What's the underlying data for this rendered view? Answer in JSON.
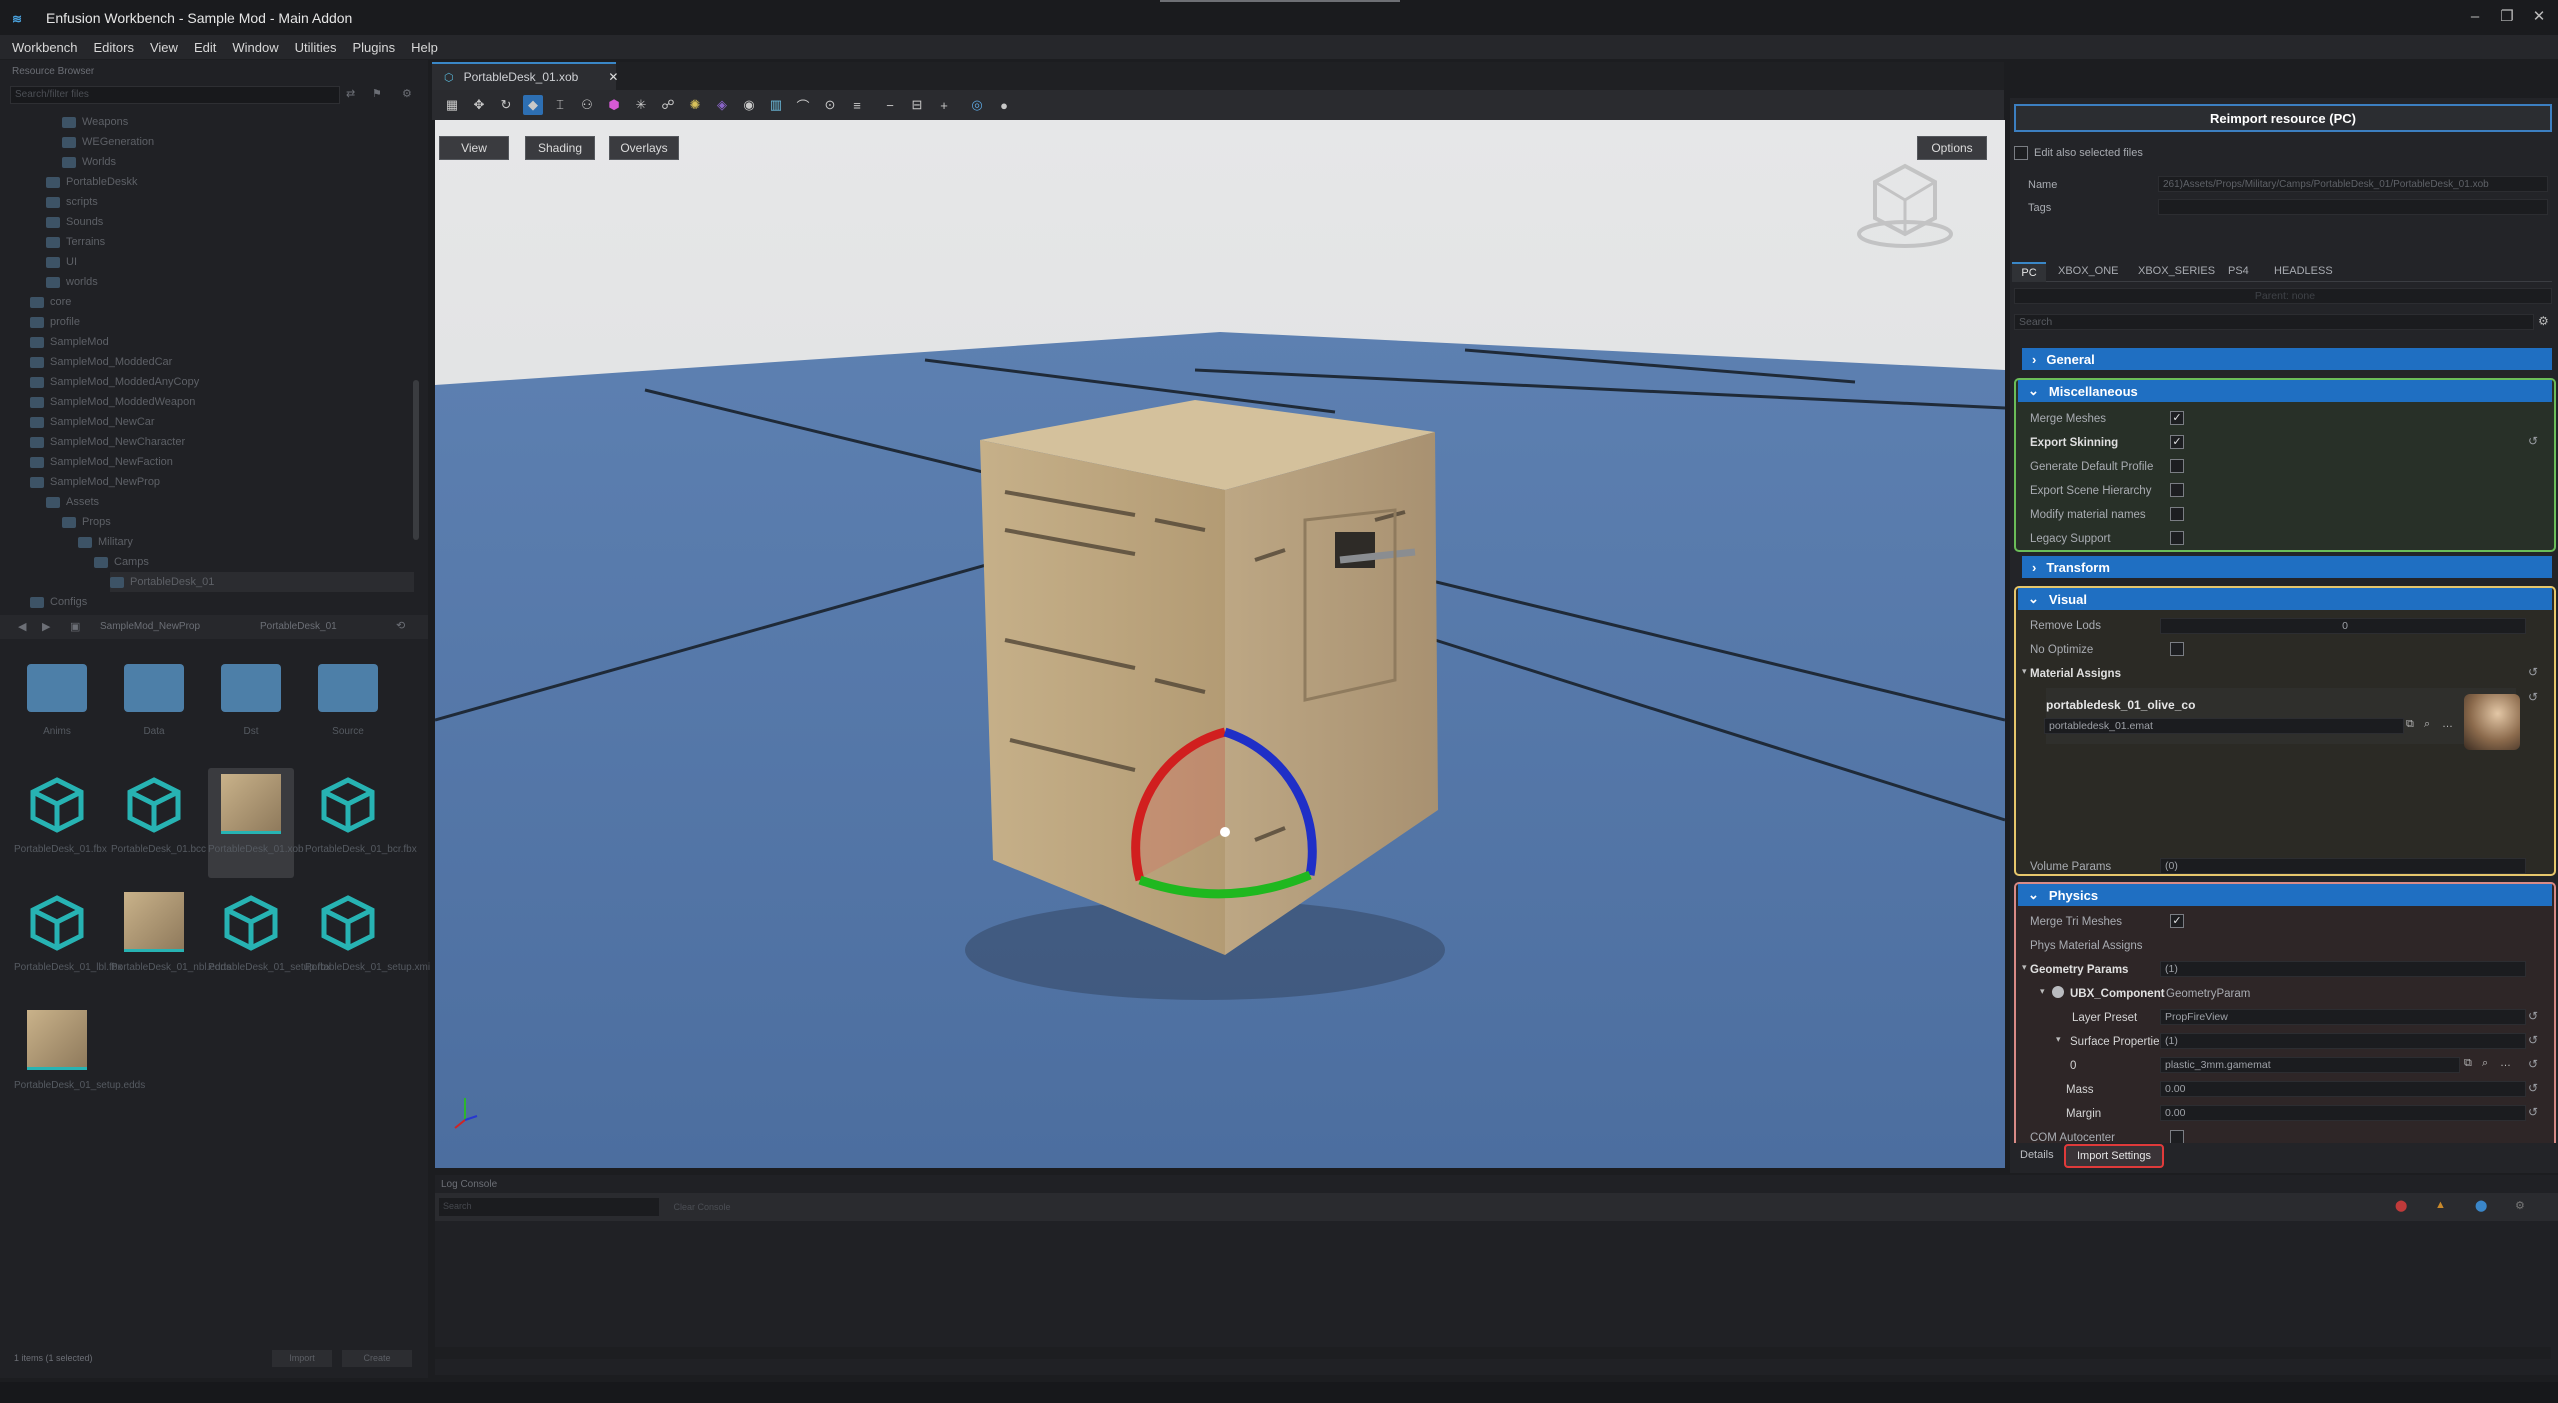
{
  "window": {
    "title": "Enfusion Workbench - Sample Mod - Main Addon",
    "minimize": "–",
    "maximize": "❐",
    "close": "✕"
  },
  "menu": [
    "Workbench",
    "Editors",
    "View",
    "Edit",
    "Window",
    "Utilities",
    "Plugins",
    "Help"
  ],
  "resource_browser": {
    "title": "Resource Browser",
    "search_placeholder": "Search/filter files",
    "tree": [
      "Weapons",
      "WEGeneration",
      "Worlds",
      "PortableDeskk",
      "scripts",
      "Sounds",
      "Terrains",
      "UI",
      "worlds",
      "core",
      "profile",
      "SampleMod",
      "SampleMod_ModdedCar",
      "SampleMod_ModdedAnyCopy",
      "SampleMod_ModdedWeapon",
      "SampleMod_NewCar",
      "SampleMod_NewCharacter",
      "SampleMod_NewFaction",
      "SampleMod_NewProp",
      "Assets",
      "Props",
      "Military",
      "Camps",
      "PortableDesk_01",
      "Configs"
    ],
    "path": [
      "SampleMod_NewProp",
      "PortableDesk_01"
    ],
    "assets": [
      {
        "label": "Anims",
        "kind": "folder"
      },
      {
        "label": "Data",
        "kind": "folder"
      },
      {
        "label": "Dst",
        "kind": "folder"
      },
      {
        "label": "Source",
        "kind": "folder"
      },
      {
        "label": "PortableDesk_01.fbx",
        "kind": "model"
      },
      {
        "label": "PortableDesk_01.bcc",
        "kind": "model"
      },
      {
        "label": "PortableDesk_01.xob",
        "kind": "image"
      },
      {
        "label": "PortableDesk_01_bcr.fbx",
        "kind": "model"
      },
      {
        "label": "PortableDesk_01_lbl.fbx",
        "kind": "model"
      },
      {
        "label": "PortableDesk_01_nbl.edds",
        "kind": "image"
      },
      {
        "label": "PortableDesk_01_setup.fbx",
        "kind": "model"
      },
      {
        "label": "PortableDesk_01_setup.xmi",
        "kind": "model"
      },
      {
        "label": "PortableDesk_01_setup.edds",
        "kind": "image"
      }
    ],
    "selection": "1 items (1 selected)",
    "import_button": "Import",
    "create_button": "Create"
  },
  "editor": {
    "tab_label": "PortableDesk_01.xob",
    "tab_close": "✕",
    "viewport_buttons": {
      "view": "View",
      "shading": "Shading",
      "overlays": "Overlays",
      "options": "Options"
    }
  },
  "details": {
    "reimport_button": "Reimport resource (PC)",
    "edit_selected": "Edit also selected files",
    "name_label": "Name",
    "name_value": "261)Assets/Props/Military/Camps/PortableDesk_01/PortableDesk_01.xob",
    "tags_label": "Tags",
    "platform_tabs": [
      "PC",
      "XBOX_ONE",
      "XBOX_SERIES",
      "PS4",
      "HEADLESS"
    ],
    "parent_label": "Parent: none",
    "search_placeholder": "Search",
    "general": "General",
    "misc": {
      "title": "Miscellaneous",
      "merge_meshes": "Merge Meshes",
      "export_skinning": "Export Skinning",
      "gen_default_profile": "Generate Default Profile",
      "export_scene_hierarchy": "Export Scene Hierarchy",
      "modify_material_names": "Modify material names",
      "legacy_support": "Legacy Support"
    },
    "transform": "Transform",
    "visual": {
      "title": "Visual",
      "remove_lods": "Remove Lods",
      "remove_lods_value": "0",
      "no_optimize": "No Optimize",
      "material_assigns": "Material Assigns",
      "material_name": "portabledesk_01_olive_co",
      "material_file": "portabledesk_01.emat",
      "volume_params": "Volume Params",
      "volume_params_value": "(0)"
    },
    "physics": {
      "title": "Physics",
      "merge_tri_meshes": "Merge Tri Meshes",
      "phys_material_assigns": "Phys Material Assigns",
      "geometry_params": "Geometry Params",
      "geometry_params_value": "(1)",
      "ubx_component": "UBX_Component",
      "geometry_param": "GeometryParam",
      "layer_preset": "Layer Preset",
      "layer_preset_value": "PropFireView",
      "surface_properties": "Surface Properties",
      "surface_properties_value": "(1)",
      "surface_index": "0",
      "surface_value": "plastic_3mm.gamemat",
      "mass": "Mass",
      "mass_value": "0.00",
      "margin": "Margin",
      "margin_value": "0.00",
      "com_autocenter": "COM Autocenter"
    },
    "bottom_tabs": {
      "details": "Details",
      "import_settings": "Import Settings"
    }
  },
  "log_console": {
    "title": "Log Console",
    "search_placeholder": "Search",
    "clear_button": "Clear Console"
  },
  "colors": {
    "accent": "#1f6fc2",
    "misc_outline": "#6bbd59",
    "visual_outline": "#e7c76c",
    "physics_outline": "#d98b87",
    "highlight": "#e03a3a"
  }
}
